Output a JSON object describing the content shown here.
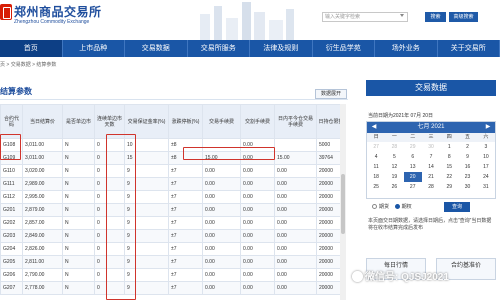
{
  "header": {
    "logo_cn": "郑州商品交易所",
    "logo_en": "Zhengzhou Commodity Exchange",
    "search_placeholder": "输入关键字检索",
    "search_button": "搜索",
    "advanced_search_button": "高级搜索"
  },
  "nav": {
    "items": [
      "首页",
      "上市品种",
      "交易数据",
      "交易所服务",
      "法律及规则",
      "衍生品学苑",
      "场外业务",
      "关于交易所"
    ],
    "active_index": 0
  },
  "breadcrumb": "页 > 交易数据 > 结算参数",
  "left_panel": {
    "title": "结算参数",
    "export_button": "数据展开"
  },
  "table": {
    "headers": [
      "合约代码",
      "当日结算价",
      "是否单边市",
      "连续单边市天数",
      "交易保证金率(%)",
      "涨跌停板(%)",
      "交易手续费",
      "交割手续费",
      "日内平今仓交易手续费",
      "日持仓限额"
    ],
    "rows": [
      [
        "G108",
        "3,011.00",
        "N",
        "0",
        "10",
        "±8",
        "",
        "0.00",
        "",
        "5000"
      ],
      [
        "G109",
        "3,011.00",
        "N",
        "0",
        "15",
        "±8",
        "15.00",
        "0.00",
        "15.00",
        "39764"
      ],
      [
        "G110",
        "3,020.00",
        "N",
        "0",
        "9",
        "±7",
        "0.00",
        "0.00",
        "0.00",
        "20000"
      ],
      [
        "G111",
        "2,989.00",
        "N",
        "0",
        "9",
        "±7",
        "0.00",
        "0.00",
        "0.00",
        "20000"
      ],
      [
        "G112",
        "2,995.00",
        "N",
        "0",
        "9",
        "±7",
        "0.00",
        "0.00",
        "0.00",
        "20000"
      ],
      [
        "G201",
        "2,879.00",
        "N",
        "0",
        "9",
        "±7",
        "0.00",
        "0.00",
        "0.00",
        "20000"
      ],
      [
        "G202",
        "2,857.00",
        "N",
        "0",
        "9",
        "±7",
        "0.00",
        "0.00",
        "0.00",
        "20000"
      ],
      [
        "G203",
        "2,849.00",
        "N",
        "0",
        "9",
        "±7",
        "0.00",
        "0.00",
        "0.00",
        "20000"
      ],
      [
        "G204",
        "2,826.00",
        "N",
        "0",
        "9",
        "±7",
        "0.00",
        "0.00",
        "0.00",
        "20000"
      ],
      [
        "G205",
        "2,811.00",
        "N",
        "0",
        "9",
        "±7",
        "0.00",
        "0.00",
        "0.00",
        "20000"
      ],
      [
        "G206",
        "2,790.00",
        "N",
        "0",
        "9",
        "±7",
        "0.00",
        "0.00",
        "0.00",
        "20000"
      ],
      [
        "G207",
        "2,778.00",
        "N",
        "0",
        "9",
        "±7",
        "0.00",
        "0.00",
        "0.00",
        "20000"
      ]
    ]
  },
  "right_panel": {
    "title": "交易数据",
    "current_date": "当前日期为2021年 07月 20日",
    "calendar": {
      "header": "七月 2021",
      "prev": "◀",
      "next": "▶",
      "weekdays": [
        "日",
        "一",
        "二",
        "三",
        "四",
        "五",
        "六"
      ],
      "days": [
        {
          "d": "27",
          "dim": true
        },
        {
          "d": "28",
          "dim": true
        },
        {
          "d": "29",
          "dim": true
        },
        {
          "d": "30",
          "dim": true
        },
        {
          "d": "1"
        },
        {
          "d": "2"
        },
        {
          "d": "3"
        },
        {
          "d": "4"
        },
        {
          "d": "5"
        },
        {
          "d": "6"
        },
        {
          "d": "7"
        },
        {
          "d": "8"
        },
        {
          "d": "9"
        },
        {
          "d": "10"
        },
        {
          "d": "11"
        },
        {
          "d": "12"
        },
        {
          "d": "13"
        },
        {
          "d": "14"
        },
        {
          "d": "15"
        },
        {
          "d": "16"
        },
        {
          "d": "17"
        },
        {
          "d": "18"
        },
        {
          "d": "19"
        },
        {
          "d": "20",
          "sel": true
        },
        {
          "d": "21"
        },
        {
          "d": "22"
        },
        {
          "d": "23"
        },
        {
          "d": "24"
        },
        {
          "d": "25"
        },
        {
          "d": "26"
        },
        {
          "d": "27"
        },
        {
          "d": "28"
        },
        {
          "d": "29"
        },
        {
          "d": "30"
        },
        {
          "d": "31"
        }
      ]
    },
    "radio_futures": "期货",
    "radio_options": "期权",
    "query_button": "查询",
    "note": "本页面交日期数据，请选择日期后，点击“查询”当日数据将在收市结算完成后发布",
    "button_daily": "每日行情",
    "button_holdings": "合约基准价"
  },
  "watermark": "微信号: QJSJ2021"
}
